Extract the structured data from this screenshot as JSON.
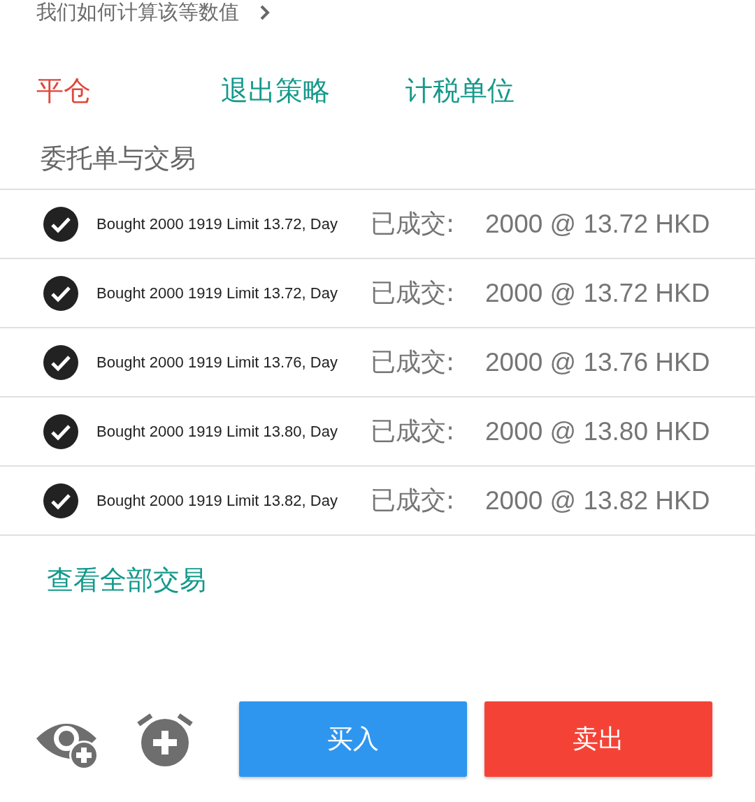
{
  "info_link": {
    "label": "我们如何计算该等数值"
  },
  "actions": [
    {
      "label": "平仓",
      "color": "#e0483c"
    },
    {
      "label": "退出策略",
      "color": "#14998b"
    },
    {
      "label": "计税单位",
      "color": "#14998b"
    }
  ],
  "orders": {
    "title": "委托单与交易",
    "rows": [
      {
        "checked": true,
        "description": "Bought 2000 1919 Limit 13.72, Day",
        "status": "已成交:",
        "fill": "2000 @ 13.72 HKD"
      },
      {
        "checked": true,
        "description": "Bought 2000 1919 Limit 13.72, Day",
        "status": "已成交:",
        "fill": "2000 @ 13.72 HKD"
      },
      {
        "checked": true,
        "description": "Bought 2000 1919 Limit 13.76, Day",
        "status": "已成交:",
        "fill": "2000 @ 13.76 HKD"
      },
      {
        "checked": true,
        "description": "Bought 2000 1919 Limit 13.80, Day",
        "status": "已成交:",
        "fill": "2000 @ 13.80 HKD"
      },
      {
        "checked": true,
        "description": "Bought 2000 1919 Limit 13.82, Day",
        "status": "已成交:",
        "fill": "2000 @ 13.82 HKD"
      }
    ],
    "view_all": "查看全部交易"
  },
  "bottom_bar": {
    "buttons": [
      {
        "label": "买入",
        "kind": "buy"
      },
      {
        "label": "卖出",
        "kind": "sell"
      }
    ]
  }
}
